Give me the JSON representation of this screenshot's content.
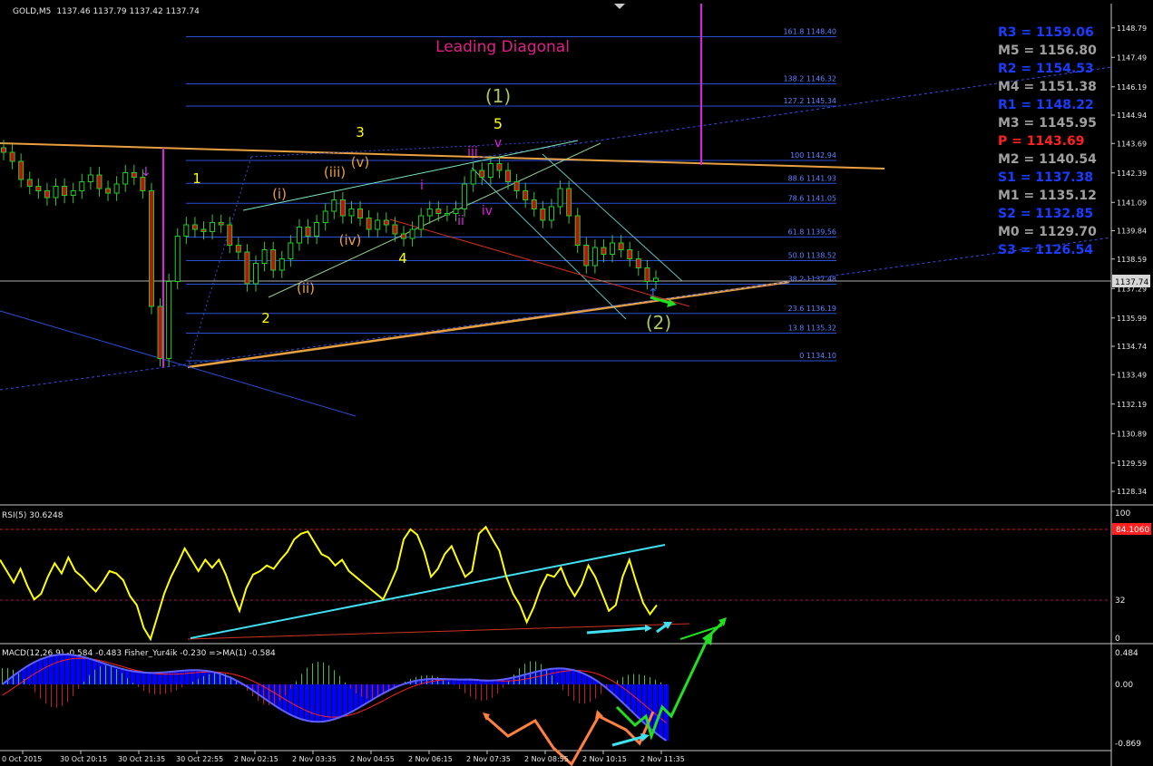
{
  "header": {
    "symbol": "GOLD,M5",
    "ohlc": "1137.46 1137.79 1137.42 1137.74"
  },
  "title": "Leading Diagonal",
  "current_price_label": "1137.74",
  "colors": {
    "background": "#000000",
    "candle": "#00c000",
    "bear_candle": "#c01010",
    "fib": "#2b4fd8",
    "trendline": "#e8a040",
    "magenta": "#e020e0",
    "rsi": "#ffff00",
    "cyan": "#40e0f0",
    "green_arrow": "#20e020",
    "orange_arrow": "#ff8040",
    "macd_hist": "#0000ff",
    "accent_pivot": "#ff2020"
  },
  "main_axis": {
    "ticks": [
      "1148.79",
      "1147.49",
      "1146.19",
      "1144.94",
      "1143.69",
      "1142.39",
      "1141.09",
      "1139.84",
      "1138.59",
      "1137.29",
      "1135.99",
      "1134.74",
      "1133.49",
      "1132.19",
      "1130.89",
      "1129.59",
      "1128.34"
    ]
  },
  "fib_levels": [
    {
      "label": "161.8 1148.40"
    },
    {
      "label": "138.2 1146.32"
    },
    {
      "label": "127.2 1145.34"
    },
    {
      "label": "100 1142.94"
    },
    {
      "label": "88.6 1141.93"
    },
    {
      "label": "78.6 1141.05"
    },
    {
      "label": "61.8 1139.56"
    },
    {
      "label": "50.0 1138.52"
    },
    {
      "label": "38.2 1137.48"
    },
    {
      "label": "23.6 1136.19"
    },
    {
      "label": "13.8 1135.32"
    },
    {
      "label": "0 1134.10"
    }
  ],
  "pivots": [
    {
      "label": "R3 = 1159.06",
      "kind": "R"
    },
    {
      "label": "M5 = 1156.80",
      "kind": "M"
    },
    {
      "label": "R2 = 1154.53",
      "kind": "R"
    },
    {
      "label": "M4 = 1151.38",
      "kind": "M"
    },
    {
      "label": "R1 = 1148.22",
      "kind": "R"
    },
    {
      "label": "M3 = 1145.95",
      "kind": "M"
    },
    {
      "label": "P  = 1143.69",
      "kind": "P"
    },
    {
      "label": "M2 = 1140.54",
      "kind": "M"
    },
    {
      "label": "S1 = 1137.38",
      "kind": "S"
    },
    {
      "label": "M1 = 1135.12",
      "kind": "M"
    },
    {
      "label": "S2 = 1132.85",
      "kind": "S"
    },
    {
      "label": "M0 = 1129.70",
      "kind": "M"
    },
    {
      "label": "S3 = 1126.54",
      "kind": "S"
    }
  ],
  "wave_labels": [
    {
      "text": "(1)",
      "color": "#a8c860"
    },
    {
      "text": "5",
      "color": "#ffff00"
    },
    {
      "text": "v",
      "color": "#e020e0"
    },
    {
      "text": "3",
      "color": "#ffff00"
    },
    {
      "text": "1",
      "color": "#ffff00"
    },
    {
      "text": "(iii)",
      "color": "#e8a040"
    },
    {
      "text": "(v)",
      "color": "#e8a040"
    },
    {
      "text": "(i)",
      "color": "#e8a040"
    },
    {
      "text": "iii",
      "color": "#e020e0"
    },
    {
      "text": "i",
      "color": "#e020e0"
    },
    {
      "text": "iv",
      "color": "#e020e0"
    },
    {
      "text": "ii",
      "color": "#e020e0"
    },
    {
      "text": "(iv)",
      "color": "#e8a040"
    },
    {
      "text": "4",
      "color": "#ffff00"
    },
    {
      "text": "(ii)",
      "color": "#e8a040"
    },
    {
      "text": "2",
      "color": "#ffff00"
    },
    {
      "text": "(2)",
      "color": "#a8c860"
    }
  ],
  "rsi": {
    "label": "RSI(5) 30.6248",
    "level_marker": "84.1060",
    "ticks": [
      "100",
      "32",
      "0"
    ]
  },
  "macd": {
    "label": "MACD(12,26,9) -0.584 -0.483  Fisher_Yur4ik -0.230  =>MA(1) -0.584",
    "ticks": [
      "0.484",
      "0.00",
      "-0.869"
    ]
  },
  "time_axis": [
    "0 Oct 2015",
    "30 Oct 20:15",
    "30 Oct 21:35",
    "30 Oct 22:55",
    "2 Nov 02:15",
    "2 Nov 03:35",
    "2 Nov 04:55",
    "2 Nov 06:15",
    "2 Nov 07:35",
    "2 Nov 08:55",
    "2 Nov 10:15",
    "2 Nov 11:35"
  ],
  "chart_data": {
    "type": "candlestick",
    "title": "Leading Diagonal",
    "symbol": "GOLD,M5",
    "ylim": [
      1127.9,
      1149.3
    ],
    "close_series_approx": [
      1143.3,
      1142.9,
      1142.1,
      1141.8,
      1141.6,
      1141.3,
      1141.8,
      1141.4,
      1141.6,
      1142.0,
      1142.3,
      1141.7,
      1141.5,
      1141.9,
      1142.4,
      1142.2,
      1141.6,
      1136.5,
      1134.2,
      1137.6,
      1139.6,
      1140.1,
      1139.9,
      1139.8,
      1140.2,
      1140.1,
      1139.2,
      1138.9,
      1137.5,
      1138.4,
      1139.0,
      1138.1,
      1138.6,
      1139.3,
      1140.0,
      1139.6,
      1140.2,
      1140.7,
      1141.2,
      1140.5,
      1140.8,
      1140.4,
      1139.9,
      1140.3,
      1140.1,
      1139.7,
      1139.5,
      1139.9,
      1140.5,
      1140.8,
      1140.6,
      1140.6,
      1140.8,
      1141.9,
      1142.5,
      1142.2,
      1142.8,
      1142.5,
      1142.0,
      1141.6,
      1141.2,
      1140.8,
      1140.3,
      1140.9,
      1141.7,
      1140.5,
      1139.2,
      1138.3,
      1139.1,
      1138.8,
      1139.3,
      1139.0,
      1138.6,
      1138.2,
      1137.6,
      1137.74
    ],
    "last_price": 1137.74,
    "fib_retracement": [
      {
        "pct": 161.8,
        "price": 1148.4
      },
      {
        "pct": 138.2,
        "price": 1146.32
      },
      {
        "pct": 127.2,
        "price": 1145.34
      },
      {
        "pct": 100,
        "price": 1142.94
      },
      {
        "pct": 88.6,
        "price": 1141.93
      },
      {
        "pct": 78.6,
        "price": 1141.05
      },
      {
        "pct": 61.8,
        "price": 1139.56
      },
      {
        "pct": 50.0,
        "price": 1138.52
      },
      {
        "pct": 38.2,
        "price": 1137.48
      },
      {
        "pct": 23.6,
        "price": 1136.19
      },
      {
        "pct": 13.8,
        "price": 1135.32
      },
      {
        "pct": 0,
        "price": 1134.1
      }
    ],
    "rsi_values_approx": [
      70,
      60,
      50,
      62,
      47,
      35,
      40,
      55,
      67,
      58,
      72,
      60,
      55,
      48,
      42,
      50,
      60,
      58,
      52,
      38,
      30,
      10,
      0,
      20,
      40,
      55,
      67,
      80,
      70,
      60,
      70,
      63,
      70,
      57,
      40,
      25,
      45,
      57,
      60,
      65,
      62,
      70,
      77,
      88,
      93,
      95,
      85,
      75,
      72,
      65,
      70,
      60,
      55,
      50,
      45,
      40,
      35,
      48,
      62,
      88,
      97,
      92,
      77,
      55,
      62,
      75,
      82,
      68,
      55,
      60,
      93,
      99,
      88,
      78,
      55,
      40,
      30,
      15,
      28,
      45,
      57,
      55,
      63,
      48,
      38,
      48,
      65,
      55,
      40,
      25,
      30,
      55,
      70,
      50,
      32,
      22,
      30
    ]
  }
}
